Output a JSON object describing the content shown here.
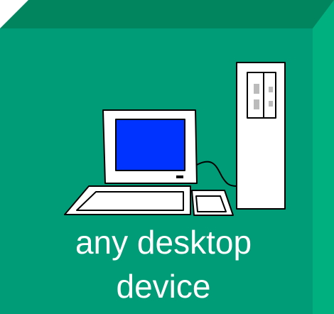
{
  "block": {
    "colors": {
      "face": "#009B77",
      "top": "#00855F",
      "side": "#00B07F",
      "text": "#FFFFFF",
      "screen": "#0033FF",
      "outline": "#000000",
      "hardware": "#FFFFFF"
    },
    "icon": "desktop-computer-icon",
    "caption_line_1": "any desktop",
    "caption_line_2": "device"
  }
}
